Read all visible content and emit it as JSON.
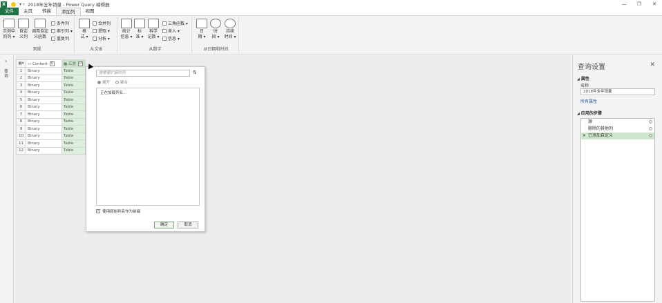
{
  "titlebar": {
    "app_icon": "X",
    "title": "2018年全年销量 - Power Query 编辑器",
    "buttons": [
      "—",
      "❐",
      "✕"
    ]
  },
  "menu": {
    "file": "文件",
    "tabs": [
      "主页",
      "转换",
      "添加列",
      "视图"
    ]
  },
  "ribbon": {
    "groups": {
      "general": "常规",
      "from_text": "从文本",
      "from_number": "从数字",
      "from_datetime": "从日期和时间"
    },
    "buttons": {
      "col_from_examples": "示例中\n的列 ▾",
      "custom_col": "自定\n义列",
      "invoke_custom_func": "调用自定\n义函数",
      "conditional_col": "条件列",
      "index_col": "索引列 ▾",
      "duplicate_col": "重复列",
      "format": "格\n式 ▾",
      "merge_cols": "合并列",
      "extract": "提取 ▾",
      "parse": "分析 ▾",
      "statistics": "统计\n信息 ▾",
      "standard": "标\n准 ▾",
      "scientific": "科学\n记数 ▾",
      "trig": "三角函数 ▾",
      "rounding": "舍入 ▾",
      "information": "信息 ▾",
      "date": "日\n期 ▾",
      "time": "时\n间 ▾",
      "duration": "持续\n时间 ▾"
    }
  },
  "left_pane": {
    "label": "查询"
  },
  "grid": {
    "headers": [
      "Content",
      "汇总"
    ],
    "rows": [
      {
        "n": "1",
        "content": "Binary",
        "summary": "Table"
      },
      {
        "n": "2",
        "content": "Binary",
        "summary": "Table"
      },
      {
        "n": "3",
        "content": "Binary",
        "summary": "Table"
      },
      {
        "n": "4",
        "content": "Binary",
        "summary": "Table"
      },
      {
        "n": "5",
        "content": "Binary",
        "summary": "Table"
      },
      {
        "n": "6",
        "content": "Binary",
        "summary": "Table"
      },
      {
        "n": "7",
        "content": "Binary",
        "summary": "Table"
      },
      {
        "n": "8",
        "content": "Binary",
        "summary": "Table"
      },
      {
        "n": "9",
        "content": "Binary",
        "summary": "Table"
      },
      {
        "n": "10",
        "content": "Binary",
        "summary": "Table"
      },
      {
        "n": "11",
        "content": "Binary",
        "summary": "Table"
      },
      {
        "n": "12",
        "content": "Binary",
        "summary": "Table"
      }
    ]
  },
  "expand_dropdown": {
    "search_placeholder": "搜索要扩展的列",
    "radio_expand": "展开",
    "radio_aggregate": "聚合",
    "loading_text": "正在加载列名...",
    "use_prefix": "使用原始列名作为前缀",
    "ok": "确定",
    "cancel": "取消"
  },
  "query_settings": {
    "title": "查询设置",
    "properties_header": "属性",
    "name_label": "名称",
    "name_value": "2018年全年销量",
    "all_properties": "所有属性",
    "applied_steps_header": "应用的步骤",
    "steps": [
      "源",
      "删除的其他列",
      "已添加自定义"
    ]
  }
}
